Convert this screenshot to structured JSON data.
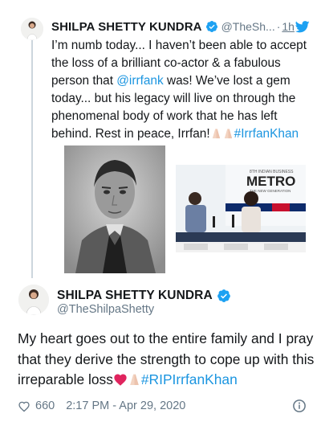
{
  "tweet1": {
    "display_name": "SHILPA SHETTY KUNDRA",
    "handle": "@TheSh...",
    "dot": "·",
    "time": "1h",
    "text_before_mention": "I’m numb today... I haven’t been able to accept the loss of a brilliant co-actor & a fabulous person that ",
    "mention": "@irrfank",
    "text_after_mention": " was! We’ve lost a gem today... but his legacy will live on through the phenomenal body of work that he has left behind. Rest in peace, Irrfan!",
    "hashtag": "#IrrfanKhan",
    "photo_banner_top": "8TH INDIAN BUSINESS",
    "photo_banner_main": "METRO",
    "photo_banner_sub": "THE NEW GENERATION"
  },
  "tweet2": {
    "display_name": "SHILPA SHETTY KUNDRA",
    "handle": "@TheShilpaShetty",
    "text_main": "My heart goes out to the entire family and I pray that they derive the strength to cope up with this irreparable loss",
    "hashtag": "#RIPIrrfanKhan",
    "likes": "660",
    "timestamp": "2:17 PM - Apr 29, 2020"
  },
  "colors": {
    "link": "#1b95e0",
    "verified": "#1da1f2",
    "secondary_text": "#657786",
    "thread_line": "#ccd6dd"
  },
  "icons": [
    "verified-badge-icon",
    "twitter-bird-icon",
    "folded-hands-emoji",
    "red-heart-emoji",
    "like-heart-icon",
    "info-icon"
  ]
}
